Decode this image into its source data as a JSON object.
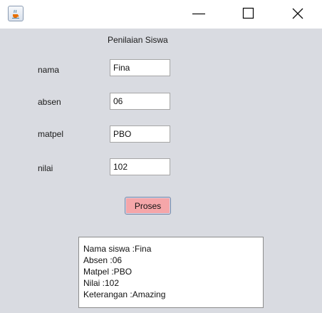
{
  "titlebar": {
    "icon": "java-cup-icon",
    "controls": {
      "minimize": "minimize-icon",
      "maximize": "maximize-icon",
      "close": "close-icon"
    }
  },
  "form": {
    "heading": "Penilaian Siswa",
    "fields": [
      {
        "label": "nama",
        "value": "Fina"
      },
      {
        "label": "absen",
        "value": "06"
      },
      {
        "label": "matpel",
        "value": "PBO"
      },
      {
        "label": "nilai",
        "value": "102"
      }
    ],
    "button_label": "Proses"
  },
  "result": {
    "lines": [
      "Nama siswa :Fina",
      "Absen :06",
      "Matpel :PBO",
      "Nilai :102",
      "Keterangan :Amazing"
    ]
  },
  "colors": {
    "panel_background": "#d9dbe1",
    "button_background": "#f5a6a9",
    "titlebar_background": "#ffffff"
  }
}
